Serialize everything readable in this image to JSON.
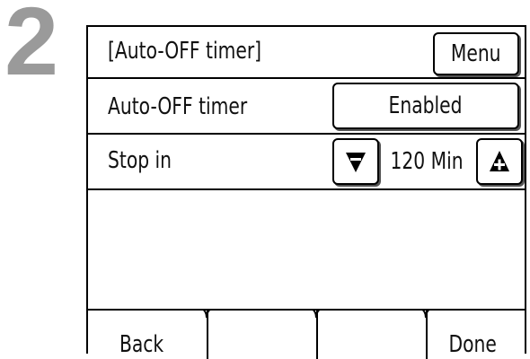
{
  "step": {
    "number": "2"
  },
  "header": {
    "title": "[Auto-OFF timer]",
    "menu_label": "Menu"
  },
  "auto_off": {
    "label": "Auto-OFF timer",
    "value": "Enabled"
  },
  "stop_in": {
    "label": "Stop in",
    "value": "120 Min",
    "decrease_icon": "triangle-down-minus",
    "increase_icon": "triangle-up-plus"
  },
  "softkeys": {
    "k1": "Back",
    "k2": "",
    "k3": "",
    "k4": "Done"
  },
  "colors": {
    "step_number": "#9a9a9a",
    "border": "#000000",
    "background": "#ffffff"
  }
}
